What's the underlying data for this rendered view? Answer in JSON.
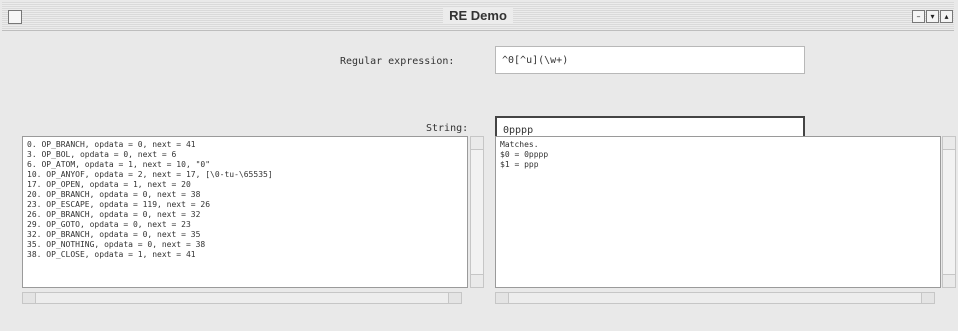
{
  "window": {
    "title": "RE Demo",
    "controls": {
      "minimize_glyph": "–",
      "maximize_glyph": "▾",
      "close_glyph": "▴"
    }
  },
  "form": {
    "regex_label": "Regular expression:",
    "regex_value": "^0[^u](\\w+)",
    "string_label": "String:",
    "string_value": "0pppp"
  },
  "program_listing": [
    "0. OP_BRANCH, opdata = 0, next = 41",
    "3. OP_BOL, opdata = 0, next = 6",
    "6. OP_ATOM, opdata = 1, next = 10, \"0\"",
    "10. OP_ANYOF, opdata = 2, next = 17, [\\0-tu-\\65535]",
    "17. OP_OPEN, opdata = 1, next = 20",
    "20. OP_BRANCH, opdata = 0, next = 38",
    "23. OP_ESCAPE, opdata = 119, next = 26",
    "26. OP_BRANCH, opdata = 0, next = 32",
    "29. OP_GOTO, opdata = 0, next = 23",
    "32. OP_BRANCH, opdata = 0, next = 35",
    "35. OP_NOTHING, opdata = 0, next = 38",
    "38. OP_CLOSE, opdata = 1, next = 41"
  ],
  "result": [
    "Matches.",
    "",
    "$0 = 0pppp",
    "$1 = ppp"
  ]
}
